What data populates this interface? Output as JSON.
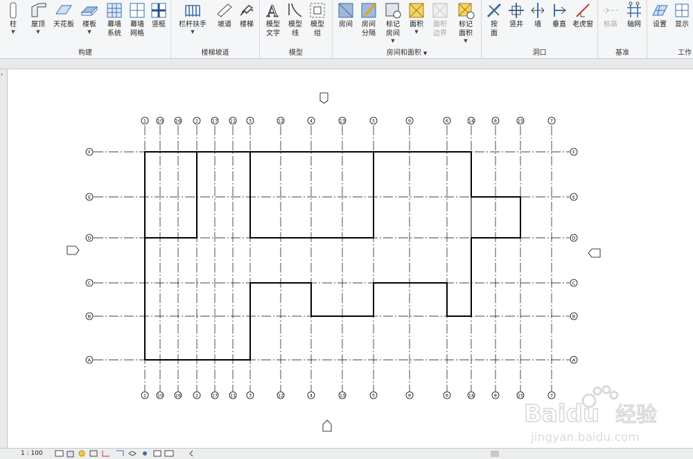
{
  "ribbon": {
    "groups": [
      {
        "label": "构建",
        "tools": [
          {
            "label": "柱",
            "icon": "column-icon",
            "dropdown": true
          },
          {
            "label": "屋顶",
            "icon": "roof-icon",
            "dropdown": true
          },
          {
            "label": "天花板",
            "icon": "ceiling-icon"
          },
          {
            "label": "楼板",
            "icon": "floor-icon",
            "dropdown": true
          },
          {
            "label": "幕墙\n系统",
            "icon": "curtain-system-icon"
          },
          {
            "label": "幕墙\n网格",
            "icon": "curtain-grid-icon"
          },
          {
            "label": "竖梃",
            "icon": "mullion-icon"
          }
        ]
      },
      {
        "label": "楼梯坡道",
        "tools": [
          {
            "label": "栏杆扶手",
            "icon": "railing-icon",
            "dropdown": true
          },
          {
            "label": "坡道",
            "icon": "ramp-icon"
          },
          {
            "label": "楼梯",
            "icon": "stair-icon"
          }
        ]
      },
      {
        "label": "模型",
        "tools": [
          {
            "label": "模型\n文字",
            "icon": "model-text-icon"
          },
          {
            "label": "模型\n线",
            "icon": "model-line-icon"
          },
          {
            "label": "模型\n组",
            "icon": "model-group-icon",
            "dropdown": true
          }
        ]
      },
      {
        "label": "房间和面积",
        "tools": [
          {
            "label": "房间",
            "icon": "room-icon"
          },
          {
            "label": "房间\n分隔",
            "icon": "room-separator-icon"
          },
          {
            "label": "标记\n房间",
            "icon": "tag-room-icon",
            "dropdown": true
          },
          {
            "label": "面积",
            "icon": "area-icon",
            "dropdown": true
          },
          {
            "label": "面积\n边界",
            "icon": "area-boundary-icon",
            "disabled": true
          },
          {
            "label": "标记\n面积",
            "icon": "tag-area-icon",
            "dropdown": true
          }
        ]
      },
      {
        "label": "洞口",
        "tools": [
          {
            "label": "按\n面",
            "icon": "by-face-icon"
          },
          {
            "label": "竖井",
            "icon": "shaft-icon"
          },
          {
            "label": "墙",
            "icon": "wall-opening-icon"
          },
          {
            "label": "垂直",
            "icon": "vertical-opening-icon"
          },
          {
            "label": "老虎窗",
            "icon": "dormer-icon"
          }
        ]
      },
      {
        "label": "基准",
        "tools": [
          {
            "label": "标高",
            "icon": "level-icon",
            "disabled": true
          },
          {
            "label": "轴网",
            "icon": "grid-icon"
          }
        ]
      },
      {
        "label": "工作",
        "tools": [
          {
            "label": "设置",
            "icon": "set-icon"
          },
          {
            "label": "显示",
            "icon": "show-icon"
          }
        ]
      }
    ],
    "group_dropdown_caret": "▼"
  },
  "drawing": {
    "vertical_grids_order": [
      "1",
      "10",
      "16",
      "2",
      "17",
      "11",
      "3",
      "12",
      "4",
      "13",
      "5",
      "9",
      "6",
      "14",
      "8",
      "15",
      "7"
    ],
    "horizontal_grids_order": [
      "F",
      "E",
      "D",
      "C",
      "B",
      "A"
    ]
  },
  "status": {
    "scale": "1 : 100"
  },
  "watermark": {
    "brand": "Baidu",
    "brand_cn": "经验",
    "url": "jingyan.baidu.com"
  },
  "colors": {
    "ribbon_bg": "#f5f6f7",
    "line": "#000000",
    "icon_blue": "#3a6fb0"
  }
}
